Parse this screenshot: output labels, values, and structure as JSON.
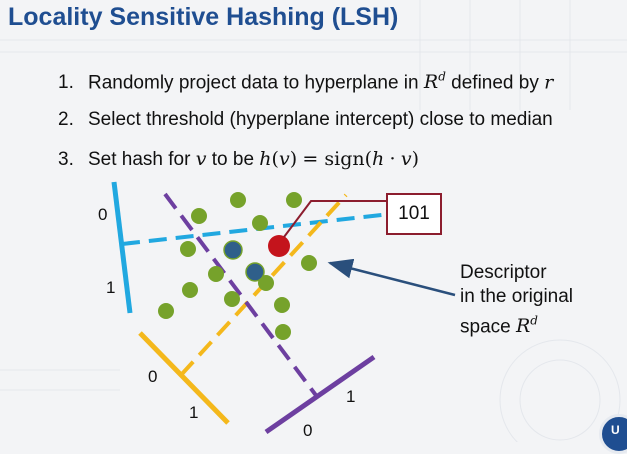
{
  "title": "Locality Sensitive Hashing (LSH)",
  "bullets": [
    {
      "num": "1.",
      "text": "Randomly project data to hyperplane in",
      "space": "R",
      "space_sup": "d",
      "tail": "defined by",
      "var": "r"
    },
    {
      "num": "2.",
      "text": "Select threshold (hyperplane intercept) close to median"
    },
    {
      "num": "3.",
      "text": "Set hash for",
      "var": "v",
      "mid": "to be",
      "formula_fn": "h",
      "formula_arg": "v",
      "formula_eq": "= sign(",
      "formula_h": "h",
      "formula_dot": "·",
      "formula_v": "v",
      "formula_close": ")"
    }
  ],
  "diagram": {
    "hash_code": "101",
    "descriptor_line1": "Descriptor",
    "descriptor_line2": "in the original",
    "descriptor_line3": "space",
    "descriptor_space": "R",
    "descriptor_sup": "d",
    "labels": {
      "cyan_0": "0",
      "cyan_1": "1",
      "yellow_0": "0",
      "yellow_1": "1",
      "purple_1": "1",
      "purple_0": "0"
    }
  },
  "colors": {
    "title": "#1f4e91",
    "cyan": "#21a8e0",
    "yellow": "#f4b81c",
    "purple": "#6d3fa0",
    "green_point": "#76a22b",
    "blue_point": "#2f5f8a",
    "red_point": "#c4141c",
    "arrow": "#2a4f7c",
    "box_border": "#8c1d2e"
  }
}
